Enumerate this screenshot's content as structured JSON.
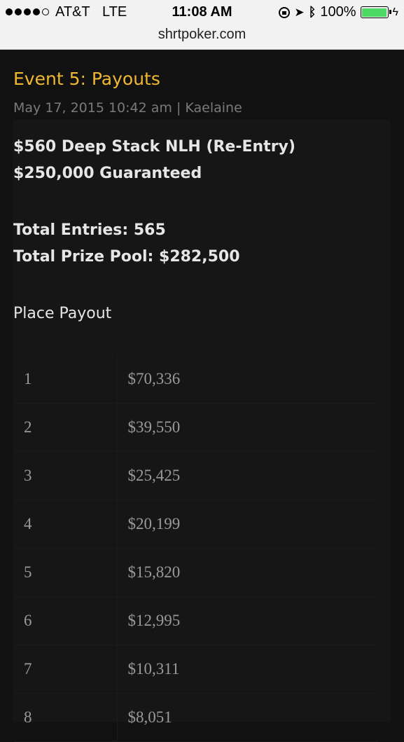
{
  "status_bar": {
    "carrier": "AT&T",
    "network": "LTE",
    "time": "11:08 AM",
    "battery_percent": "100%",
    "battery_level": 1.0,
    "signal_bars_filled": 4,
    "signal_bars_total": 5
  },
  "browser": {
    "url": "shrtpoker.com"
  },
  "post": {
    "title": "Event 5: Payouts",
    "meta": "May 17, 2015 10:42 am | Kaelaine",
    "event_name": "$560 Deep Stack NLH (Re-Entry)",
    "guarantee": "$250,000 Guaranteed",
    "entries": "Total Entries:  565",
    "prize_pool": "Total Prize Pool:  $282,500",
    "table_header": "Place  Payout"
  },
  "payouts": [
    {
      "place": "1",
      "amount": "$70,336"
    },
    {
      "place": "2",
      "amount": "$39,550"
    },
    {
      "place": "3",
      "amount": "$25,425"
    },
    {
      "place": "4",
      "amount": "$20,199"
    },
    {
      "place": "5",
      "amount": "$15,820"
    },
    {
      "place": "6",
      "amount": "$12,995"
    },
    {
      "place": "7",
      "amount": "$10,311"
    },
    {
      "place": "8",
      "amount": "$8,051"
    }
  ],
  "colors": {
    "title": "#f0b830",
    "background": "#111111",
    "battery": "#4cd964"
  }
}
